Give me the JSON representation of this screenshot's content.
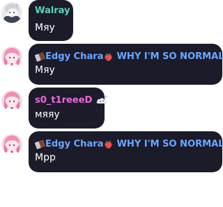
{
  "colors": {
    "bubble_bg": "#1c1b2a",
    "message_text": "#ffffff",
    "walray_name": "#5fd1b4",
    "edgy_name": "#6aa6ff",
    "edgy_title": "#6aa6ff",
    "s0_name": "#e86ad8"
  },
  "messages": [
    {
      "author": "Walray",
      "text": "Мяу",
      "avatar_icon": "white-haired-character-avatar"
    },
    {
      "author_prefix_icon": "chocolate-bar-icon",
      "author": "Edgy Chara",
      "author_suffix_icon": "strawberry-icon",
      "author_title": "WHY I'M SO NORMAL?",
      "text": "Мяу",
      "avatar_icon": "pink-haired-character-avatar"
    },
    {
      "author": "s0_t1reeeD",
      "author_badge_icon": "sleepy-cloud-icon",
      "text": "мяяу",
      "avatar_icon": "pink-haired-character-avatar"
    },
    {
      "author_prefix_icon": "chocolate-bar-icon",
      "author": "Edgy Chara",
      "author_suffix_icon": "strawberry-icon",
      "author_title": "WHY I'M SO NORMAL?",
      "text": "Мрр",
      "avatar_icon": "pink-haired-character-avatar"
    }
  ]
}
